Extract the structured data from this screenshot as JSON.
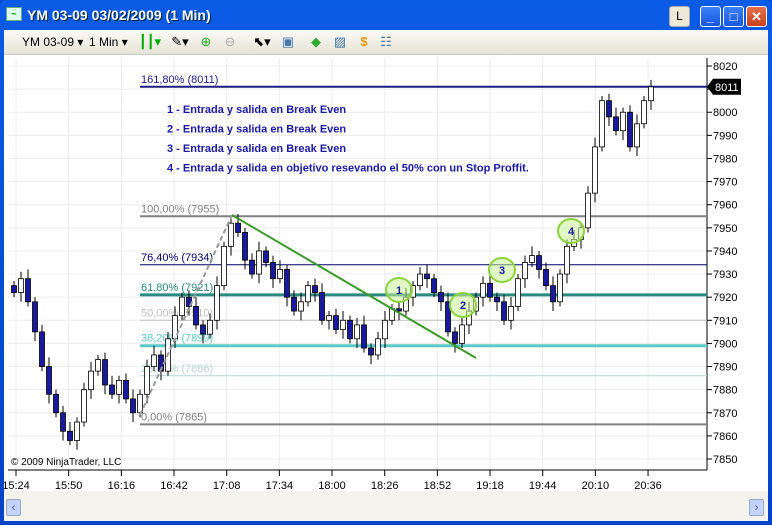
{
  "window": {
    "title": "YM 03-09  03/02/2009 (1 Min)",
    "l_button": "L",
    "minimize": "_",
    "maximize": "□",
    "close": "✕"
  },
  "toolbar": {
    "instrument": "YM 03-09",
    "interval": "1 Min",
    "icons": [
      "candlestick-icon",
      "pencil-icon",
      "zoom-in-icon",
      "zoom-out-icon",
      "pointer-icon",
      "properties-icon",
      "data-box-icon",
      "indicators-icon",
      "strategy-dollar-icon",
      "table-icon"
    ]
  },
  "copyright": "© 2009 NinjaTrader, LLC",
  "notes": [
    "1 - Entrada y salida en Break Even",
    "2 - Entrada y salida en Break Even",
    "3 - Entrada y salida en Break Even",
    "4 - Entrada y salida en objetivo resevando el 50% con un Stop Proffit."
  ],
  "trade_markers": [
    "1",
    "2",
    "3",
    "4"
  ],
  "chart_data": {
    "type": "candlestick",
    "ylim": [
      7845,
      8025
    ],
    "y_ticks": [
      "8020",
      "8010",
      "8000",
      "7990",
      "7980",
      "7970",
      "7960",
      "7950",
      "7940",
      "7930",
      "7920",
      "7910",
      "7900",
      "7890",
      "7880",
      "7870",
      "7860",
      "7850"
    ],
    "x_ticks": [
      "15:24",
      "15:50",
      "16:16",
      "16:42",
      "17:08",
      "17:34",
      "18:00",
      "18:26",
      "18:52",
      "19:18",
      "19:44",
      "20:10",
      "20:36"
    ],
    "last_price": "8011",
    "closes": [
      7922,
      7928,
      7918,
      7905,
      7890,
      7878,
      7870,
      7862,
      7858,
      7866,
      7880,
      7888,
      7893,
      7882,
      7878,
      7884,
      7876,
      7870,
      7878,
      7890,
      7895,
      7888,
      7902,
      7912,
      7920,
      7916,
      7908,
      7904,
      7910,
      7925,
      7942,
      7952,
      7948,
      7936,
      7930,
      7940,
      7935,
      7928,
      7932,
      7920,
      7914,
      7918,
      7925,
      7922,
      7910,
      7912,
      7906,
      7910,
      7902,
      7908,
      7898,
      7895,
      7902,
      7910,
      7915,
      7914,
      7920,
      7925,
      7930,
      7928,
      7922,
      7918,
      7905,
      7900,
      7908,
      7914,
      7920,
      7926,
      7920,
      7918,
      7910,
      7916,
      7928,
      7935,
      7938,
      7932,
      7925,
      7918,
      7930,
      7942,
      7945,
      7950,
      7965,
      7985,
      8005,
      7998,
      7992,
      8000,
      7985,
      7995,
      8005,
      8011
    ],
    "up_color": "#ffffff",
    "down_color": "#1a1aa0",
    "fib_levels": [
      {
        "label": "161,80% (8011)",
        "price": 8011,
        "color": "#1c1c80"
      },
      {
        "label": "100,00% (7955)",
        "price": 7955,
        "color": "#808080"
      },
      {
        "label": "76,40% (7934)",
        "price": 7934,
        "color": "#000066"
      },
      {
        "label": "61,80% (7921)",
        "price": 7921,
        "color": "#2a8a80"
      },
      {
        "label": "50,00% (7910)",
        "price": 7910,
        "color": "#c0c0c0"
      },
      {
        "label": "38,20% (7899)",
        "price": 7899,
        "color": "#5ec8c8"
      },
      {
        "label": "23,60% (7886)",
        "price": 7886,
        "color": "#b8d4d4"
      },
      {
        "label": "0,00% (7865)",
        "price": 7865,
        "color": "#808080"
      }
    ],
    "trendline_color": "#3a9a2a"
  }
}
